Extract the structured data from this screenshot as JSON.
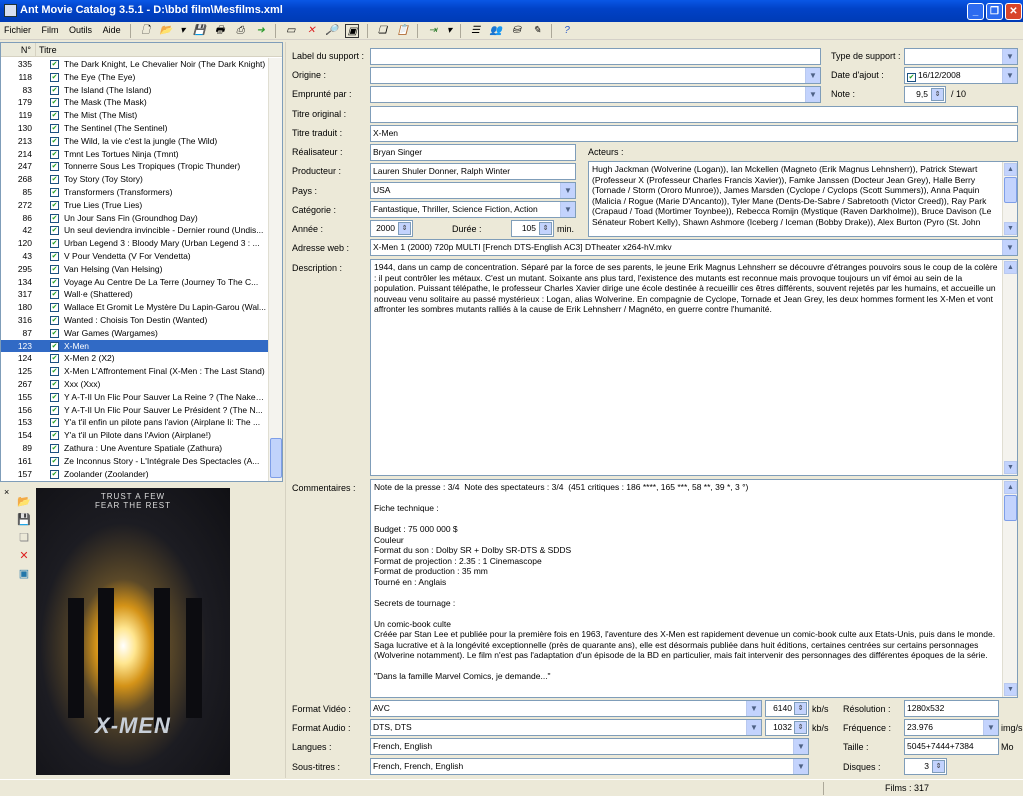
{
  "window": {
    "title": "Ant Movie Catalog 3.5.1 - D:\\bbd film\\Mesfilms.xml"
  },
  "menu": [
    "Fichier",
    "Film",
    "Outils",
    "Aide"
  ],
  "list": {
    "col_num": "N°",
    "col_title": "Titre",
    "rows": [
      {
        "num": "335",
        "title": "The Dark Knight, Le Chevalier Noir (The Dark Knight)"
      },
      {
        "num": "118",
        "title": "The Eye (The Eye)"
      },
      {
        "num": "83",
        "title": "The Island (The Island)"
      },
      {
        "num": "179",
        "title": "The Mask (The Mask)"
      },
      {
        "num": "119",
        "title": "The Mist (The Mist)"
      },
      {
        "num": "130",
        "title": "The Sentinel (The Sentinel)"
      },
      {
        "num": "213",
        "title": "The Wild, la vie c'est la jungle (The Wild)"
      },
      {
        "num": "214",
        "title": "Tmnt Les Tortues Ninja (Tmnt)"
      },
      {
        "num": "247",
        "title": "Tonnerre Sous Les Tropiques (Tropic Thunder)"
      },
      {
        "num": "268",
        "title": "Toy Story (Toy Story)"
      },
      {
        "num": "85",
        "title": "Transformers (Transformers)"
      },
      {
        "num": "272",
        "title": "True Lies (True Lies)"
      },
      {
        "num": "86",
        "title": "Un Jour Sans Fin (Groundhog Day)"
      },
      {
        "num": "42",
        "title": "Un seul deviendra invincible - Dernier round (Undis..."
      },
      {
        "num": "120",
        "title": "Urban Legend 3 : Bloody Mary (Urban Legend 3 : ..."
      },
      {
        "num": "43",
        "title": "V Pour Vendetta (V For Vendetta)"
      },
      {
        "num": "295",
        "title": "Van Helsing (Van Helsing)"
      },
      {
        "num": "134",
        "title": "Voyage Au Centre De La Terre (Journey To The C..."
      },
      {
        "num": "317",
        "title": "Wall·e (Shattered)"
      },
      {
        "num": "180",
        "title": "Wallace Et Gromit Le Mystère Du Lapin-Garou (Wal..."
      },
      {
        "num": "316",
        "title": "Wanted : Choisis Ton Destin (Wanted)"
      },
      {
        "num": "87",
        "title": "War Games (Wargames)"
      },
      {
        "num": "123",
        "title": "X-Men",
        "selected": true
      },
      {
        "num": "124",
        "title": "X-Men 2 (X2)"
      },
      {
        "num": "125",
        "title": "X-Men L'Affrontement Final (X-Men : The Last Stand)"
      },
      {
        "num": "267",
        "title": "Xxx (Xxx)"
      },
      {
        "num": "155",
        "title": "Y A-T-Il Un Flic Pour Sauver La Reine ? (The Naked..."
      },
      {
        "num": "156",
        "title": "Y A-T-Il Un Flic Pour Sauver Le Président ? (The N..."
      },
      {
        "num": "153",
        "title": "Y'a t'il enfin un pilote pans l'avion (Airplane Ii: The ..."
      },
      {
        "num": "154",
        "title": "Y'a t'il un Pilote dans l'Avion (Airplane!)"
      },
      {
        "num": "89",
        "title": "Zathura : Une Aventure Spatiale (Zathura)"
      },
      {
        "num": "161",
        "title": "Ze Inconnus Story - L'Intégrale Des Spectacles (A..."
      },
      {
        "num": "157",
        "title": "Zoolander (Zoolander)"
      }
    ]
  },
  "poster": {
    "tagline": "TRUST A FEW\nFEAR THE REST",
    "logo": "X-MEN"
  },
  "form": {
    "label_support": "Label du support :",
    "type_support": "Type de support :",
    "origine": "Origine :",
    "date_ajout_label": "Date d'ajout :",
    "date_ajout": "16/12/2008",
    "emprunte": "Emprunté par :",
    "note_label": "Note :",
    "note": "9,5",
    "note_max": "/ 10",
    "titre_original": "Titre original :",
    "titre_traduit_label": "Titre traduit :",
    "titre_traduit": "X-Men",
    "realisateur_label": "Réalisateur :",
    "realisateur": "Bryan Singer",
    "producteur_label": "Producteur :",
    "producteur": "Lauren Shuler Donner, Ralph Winter",
    "acteurs_label": "Acteurs :",
    "acteurs": "Hugh Jackman (Wolverine (Logan)), Ian Mckellen (Magneto (Erik Magnus Lehnsherr)), Patrick Stewart (Professeur X (Professeur Charles Francis Xavier)), Famke Janssen (Docteur Jean Grey), Halle Berry (Tornade / Storm (Ororo Munroe)), James Marsden (Cyclope / Cyclops (Scott Summers)), Anna Paquin (Malicia / Rogue (Marie D'Ancanto)), Tyler Mane (Dents-De-Sabre / Sabretooth (Victor Creed)), Ray Park (Crapaud / Toad (Mortimer Toynbee)), Rebecca Romijn (Mystique (Raven Darkholme)), Bruce Davison (Le Sénateur Robert Kelly), Shawn Ashmore (Iceberg / Iceman (Bobby Drake)), Alex Burton (Pyro (St. John",
    "pays_label": "Pays :",
    "pays": "USA",
    "categorie_label": "Catégorie :",
    "categorie": "Fantastique, Thriller, Science Fiction, Action",
    "annee_label": "Année :",
    "annee": "2000",
    "duree_label": "Durée :",
    "duree": "105",
    "duree_unit": "min.",
    "adresse_label": "Adresse web :",
    "adresse": "X-Men 1 (2000) 720p  MULTI [French DTS-English AC3] DTheater x264-hV.mkv",
    "description_label": "Description :",
    "description": "1944, dans un camp de concentration. Séparé par la force de ses parents, le jeune Erik Magnus Lehnsherr se découvre d'étranges pouvoirs sous le coup de la colère : il peut contrôler les métaux. C'est un mutant. Soixante ans plus tard, l'existence des mutants est reconnue mais provoque toujours un vif émoi au sein de la population. Puissant télépathe, le professeur Charles Xavier dirige une école destinée à recueillir ces êtres différents, souvent rejetés par les humains, et accueille un nouveau venu solitaire au passé mystérieux : Logan, alias Wolverine. En compagnie de Cyclope, Tornade et Jean Grey, les deux hommes forment les X-Men et vont affronter les sombres mutants ralliés à la cause de Erik Lehnsherr / Magnéto, en guerre contre l'humanité.",
    "commentaires_label": "Commentaires :",
    "commentaires": "Note de la presse : 3/4  Note des spectateurs : 3/4  (451 critiques : 186 ****, 165 ***, 58 **, 39 *, 3 °)\n\nFiche technique :\n\nBudget : 75 000 000 $\nCouleur\nFormat du son : Dolby SR + Dolby SR-DTS & SDDS\nFormat de projection : 2.35 : 1 Cinemascope\nFormat de production : 35 mm\nTourné en : Anglais\n\nSecrets de tournage :\n\nUn comic-book culte\nCréée par Stan Lee et publiée pour la première fois en 1963, l'aventure des X-Men est rapidement devenue un comic-book culte aux Etats-Unis, puis dans le monde. Saga lucrative et à la longévité exceptionnelle (près de quarante ans), elle est désormais publiée dans huit éditions, certaines centrées sur certains personnages (Wolverine notamment). Le film n'est pas l'adaptation d'un épisode de la BD en particulier, mais fait intervenir des personnages des différentes époques de la série.\n\n\"Dans la famille Marvel Comics, je demande...\"",
    "format_video_label": "Format Vidéo :",
    "format_video": "AVC",
    "video_bitrate": "6140",
    "video_unit": "kb/s",
    "resolution_label": "Résolution :",
    "resolution": "1280x532",
    "format_audio_label": "Format Audio :",
    "format_audio": "DTS, DTS",
    "audio_bitrate": "1032",
    "audio_unit": "kb/s",
    "frequence_label": "Fréquence :",
    "frequence": "23.976",
    "frequence_unit": "img/s",
    "langues_label": "Langues :",
    "langues": "French, English",
    "taille_label": "Taille :",
    "taille": "5045+7444+7384",
    "taille_unit": "Mo",
    "soustitres_label": "Sous-titres :",
    "soustitres": "French, French, English",
    "disques_label": "Disques :",
    "disques": "3"
  },
  "status": {
    "films": "Films : 317"
  }
}
